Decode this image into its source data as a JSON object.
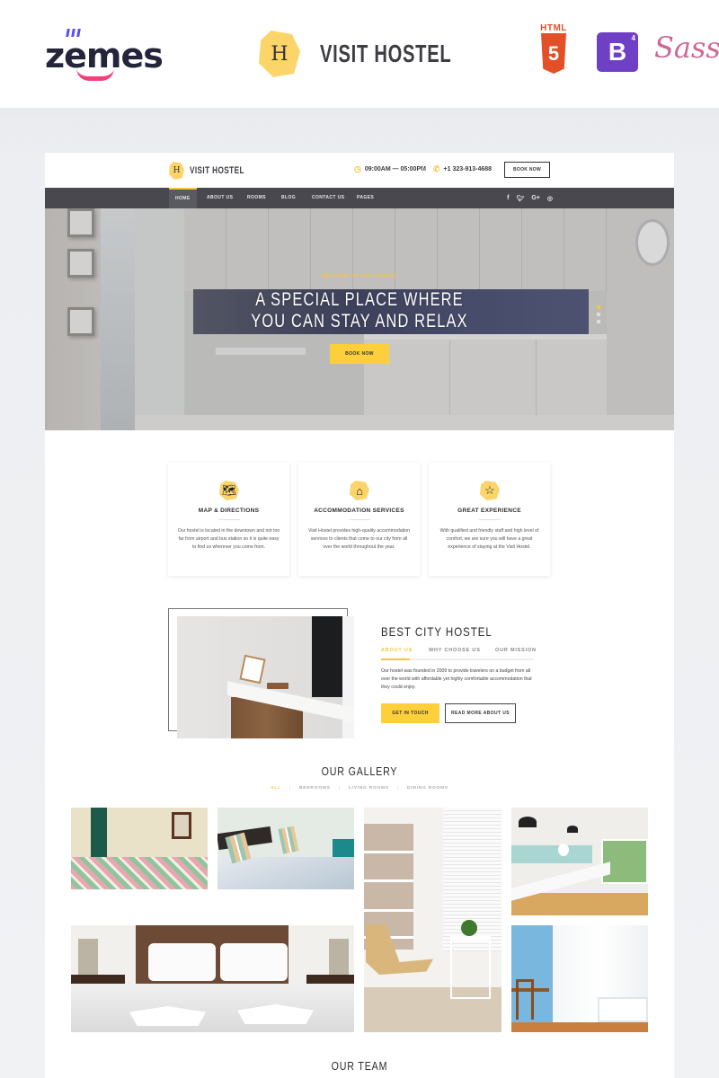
{
  "banner": {
    "vendor_logo": "zemes",
    "product_name": "VISIT HOSTEL",
    "product_logo_glyph": "H",
    "tech_badges": [
      {
        "name": "html5-icon",
        "label": "HTML",
        "glyph": "5"
      },
      {
        "name": "bootstrap-icon",
        "glyph": "B",
        "version": "4"
      },
      {
        "name": "sass-icon",
        "glyph": "Sass"
      }
    ]
  },
  "header": {
    "logo_glyph": "H",
    "site_name": "VISIT HOSTEL",
    "hours": "09:00AM — 05:00PM",
    "phone": "+1 323-913-4688",
    "book_label": "BOOK NOW",
    "clock_icon": "◷",
    "phone_icon": "✆"
  },
  "nav": {
    "items": [
      {
        "label": "HOME",
        "active": true
      },
      {
        "label": "ABOUT US",
        "active": false
      },
      {
        "label": "ROOMS",
        "active": false
      },
      {
        "label": "BLOG",
        "active": false
      },
      {
        "label": "CONTACT US",
        "active": false
      },
      {
        "label": "PAGES",
        "active": false
      }
    ],
    "social": [
      {
        "name": "facebook-icon",
        "glyph": "f"
      },
      {
        "name": "twitter-icon",
        "glyph": "🐦︎"
      },
      {
        "name": "google-plus-icon",
        "glyph": "G+"
      },
      {
        "name": "instagram-icon",
        "glyph": "◎"
      }
    ]
  },
  "hero": {
    "welcome": "WELCOME TO VISIT HOSTEL",
    "title_line1": "A SPECIAL PLACE WHERE",
    "title_line2": "YOU CAN STAY AND RELAX",
    "cta": "BOOK NOW",
    "slides_total": 3,
    "active_slide": 1
  },
  "features": [
    {
      "icon": "map-icon",
      "glyph": "🗺︎",
      "title": "MAP & DIRECTIONS",
      "text": "Our hostel is located in the downtown and not too far from airport and bus station so it is quite easy to find us wherever you come from."
    },
    {
      "icon": "home-icon",
      "glyph": "⌂",
      "title": "ACCOMMODATION SERVICES",
      "text": "Visit Hostel provides high-quality accommodation services to clients that come to our city from all over the world throughout the year."
    },
    {
      "icon": "star-icon",
      "glyph": "☆",
      "title": "GREAT EXPERIENCE",
      "text": "With qualified and friendly staff and high level of comfort, we are sure you will have a great experience of staying at the Visit Hostel."
    }
  ],
  "about": {
    "title": "BEST CITY HOSTEL",
    "tabs": [
      {
        "label": "ABOUT US",
        "active": true
      },
      {
        "label": "WHY CHOOSE US",
        "active": false
      },
      {
        "label": "OUR MISSION",
        "active": false
      }
    ],
    "text": "Our hostel was founded in 2009 to provide travelers on a budget from all over the world with affordable yet highly comfortable accommodation that they could enjoy.",
    "primary_button": "GET IN TOUCH",
    "secondary_button": "READ MORE ABOUT US"
  },
  "gallery": {
    "title": "OUR GALLERY",
    "filters": [
      {
        "label": "ALL",
        "active": true
      },
      {
        "label": "BEDROOMS",
        "active": false
      },
      {
        "label": "LIVING ROOMS",
        "active": false
      },
      {
        "label": "DINING ROOMS",
        "active": false
      }
    ],
    "images": [
      {
        "name": "gallery-image-twin-bedroom"
      },
      {
        "name": "gallery-image-striped-pillows-bedroom"
      },
      {
        "name": "gallery-image-living-room-chair"
      },
      {
        "name": "gallery-image-kitchen"
      },
      {
        "name": "gallery-image-double-bed-towels"
      },
      {
        "name": "gallery-image-bright-room"
      }
    ]
  },
  "team": {
    "title": "OUR TEAM"
  }
}
